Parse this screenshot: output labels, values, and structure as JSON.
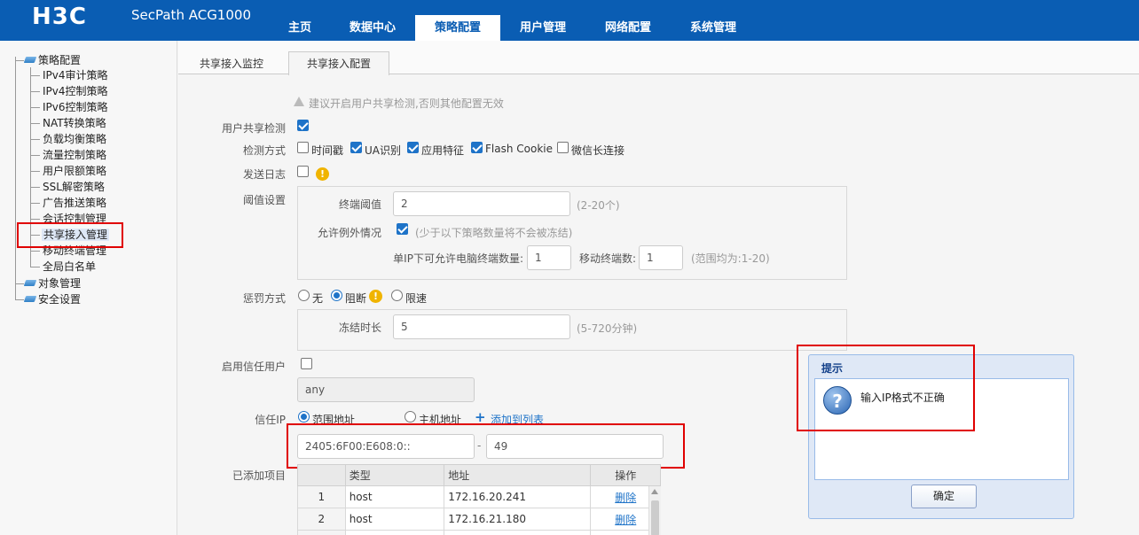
{
  "header": {
    "logo": "H3C",
    "product": "SecPath ACG1000",
    "nav": [
      {
        "label": "主页"
      },
      {
        "label": "数据中心"
      },
      {
        "label": "策略配置"
      },
      {
        "label": "用户管理"
      },
      {
        "label": "网络配置"
      },
      {
        "label": "系统管理"
      }
    ],
    "active_nav": "策略配置"
  },
  "sidebar": {
    "root": "策略配置",
    "items": [
      "IPv4审计策略",
      "IPv4控制策略",
      "IPv6控制策略",
      "NAT转换策略",
      "负载均衡策略",
      "流量控制策略",
      "用户限额策略",
      "SSL解密策略",
      "广告推送策略",
      "会话控制管理",
      "共享接入管理",
      "移动终端管理",
      "全局白名单"
    ],
    "selected": "共享接入管理",
    "others": [
      "对象管理",
      "安全设置"
    ]
  },
  "tabs": [
    {
      "label": "共享接入监控"
    },
    {
      "label": "共享接入配置"
    }
  ],
  "form": {
    "notice": "建议开启用户共享检测,否则其他配置无效",
    "share_detect": {
      "label": "用户共享检测",
      "checked": true
    },
    "detect_method": {
      "label": "检测方式",
      "options": [
        {
          "label": "时间戳",
          "checked": false
        },
        {
          "label": "UA识别",
          "checked": true
        },
        {
          "label": "应用特征",
          "checked": true
        },
        {
          "label": "Flash Cookie",
          "checked": true
        },
        {
          "label": "微信长连接",
          "checked": false
        }
      ]
    },
    "send_log": {
      "label": "发送日志",
      "checked": false
    },
    "threshold": {
      "label": "阈值设置",
      "terminal_label": "终端阈值",
      "terminal_value": "2",
      "terminal_hint": "(2-20个)",
      "exception_label": "允许例外情况",
      "exception_checked": true,
      "exception_hint": "(少于以下策略数量将不会被冻结)",
      "pc_label": "单IP下可允许电脑终端数量:",
      "pc_value": "1",
      "mobile_label": "移动终端数:",
      "mobile_value": "1",
      "range_hint": "(范围均为:1-20)"
    },
    "punish": {
      "label": "惩罚方式",
      "options": [
        {
          "label": "无",
          "selected": false
        },
        {
          "label": "阻断",
          "selected": true
        },
        {
          "label": "限速",
          "selected": false
        }
      ],
      "freeze_label": "冻结时长",
      "freeze_value": "5",
      "freeze_hint": "(5-720分钟)"
    },
    "trust_user": {
      "label": "启用信任用户",
      "checked": false,
      "value": "any"
    },
    "trust_ip": {
      "label": "信任IP",
      "range_option": "范围地址",
      "host_option": "主机地址",
      "selected": "范围地址",
      "add_link": "添加到列表",
      "start_ip": "2405:6F00:E608:0::",
      "separator": "-",
      "end_ip": "49"
    },
    "added": {
      "label": "已添加项目",
      "columns": [
        "",
        "类型",
        "地址",
        "操作"
      ],
      "rows": [
        {
          "num": "1",
          "type": "host",
          "addr": "172.16.20.241",
          "op": "删除"
        },
        {
          "num": "2",
          "type": "host",
          "addr": "172.16.21.180",
          "op": "删除"
        }
      ]
    }
  },
  "dialog": {
    "title": "提示",
    "message": "输入IP格式不正确",
    "ok": "确定"
  },
  "colors": {
    "brand": "#0a5db3",
    "accent": "#1e73c8",
    "highlight": "#e00000",
    "warning": "#f0b400"
  }
}
